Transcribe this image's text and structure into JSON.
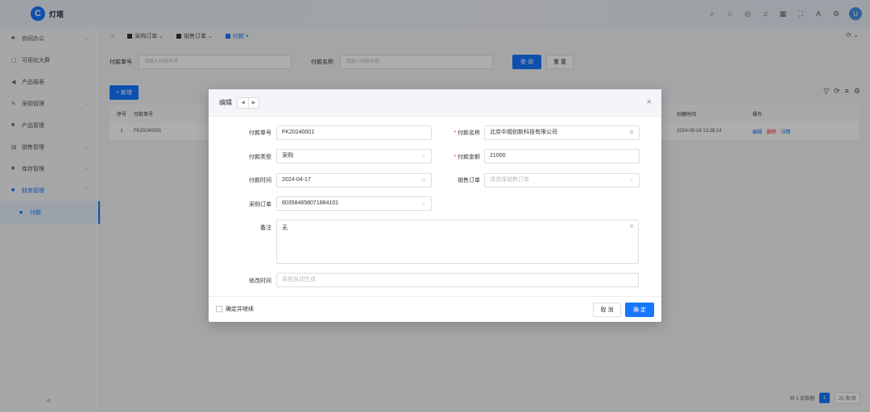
{
  "app": {
    "logo_letter": "C",
    "name": "灯塔"
  },
  "top_icons": [
    "search-icon",
    "star-icon",
    "message-icon",
    "bell-icon",
    "grid-icon",
    "expand-icon",
    "translate-icon",
    "settings-icon"
  ],
  "avatar_letter": "U",
  "sidebar": {
    "items": [
      {
        "label": "协同办公"
      },
      {
        "label": "可视化大屏"
      },
      {
        "label": "产品报表"
      },
      {
        "label": "采购管理"
      },
      {
        "label": "产品管理"
      },
      {
        "label": "销售管理"
      },
      {
        "label": "库存管理"
      },
      {
        "label": "财务管理"
      }
    ],
    "sub_active": "付款",
    "collapse": "«"
  },
  "tabs": [
    {
      "label": "采购订单"
    },
    {
      "label": "销售订单"
    },
    {
      "label": "付款"
    }
  ],
  "search": {
    "code_label": "付款单号",
    "code_placeholder": "请输入付款单号",
    "name_label": "付款名称",
    "name_placeholder": "请输入付款名称",
    "query_btn": "查 询",
    "reset_btn": "重 置"
  },
  "add_btn": "+ 新增",
  "table": {
    "headers": {
      "no": "序号",
      "code": "付款单号",
      "created": "创建时间",
      "op": "操作"
    },
    "rows": [
      {
        "no": "1",
        "code": "FK20240001",
        "created": "2024-09-18 13:28:14",
        "edit": "编辑",
        "del": "删除",
        "detail": "详情"
      }
    ]
  },
  "pager": {
    "total": "共 1 条数据",
    "page": "1",
    "size": "20 条/页"
  },
  "modal": {
    "title": "编辑",
    "close": "×",
    "fields": {
      "code_label": "付款单号",
      "code_value": "FK20240001",
      "name_label": "付款名称",
      "name_value": "北京中烟创新科技有限公司",
      "type_label": "付款类型",
      "type_value": "采购",
      "amount_label": "付款金额",
      "amount_value": "21000",
      "time_label": "付款时间",
      "time_value": "2024-04-17",
      "sales_label": "销售订单",
      "sales_placeholder": "请选择销售订单",
      "purchase_label": "采购订单",
      "purchase_value": "603584658071884101",
      "remark_label": "备注",
      "remark_value": "无",
      "modified_label": "修改时间",
      "modified_placeholder": "系统自动生成"
    },
    "footer": {
      "continue_label": "确定并继续",
      "cancel": "取 消",
      "ok": "确 定"
    }
  }
}
